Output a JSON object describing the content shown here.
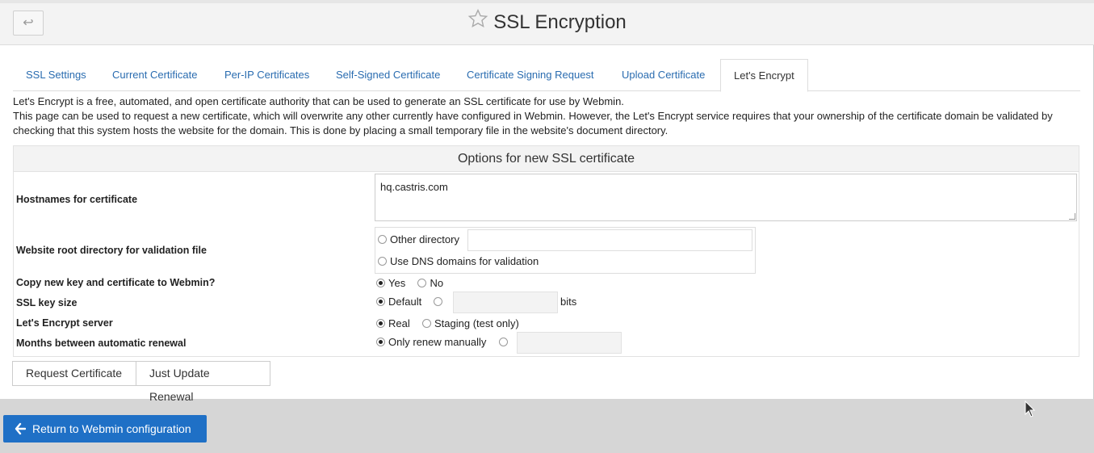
{
  "header": {
    "back_glyph": "↩",
    "title": "SSL Encryption"
  },
  "tabs": [
    {
      "label": "SSL Settings"
    },
    {
      "label": "Current Certificate"
    },
    {
      "label": "Per-IP Certificates"
    },
    {
      "label": "Self-Signed Certificate"
    },
    {
      "label": "Certificate Signing Request"
    },
    {
      "label": "Upload Certificate"
    },
    {
      "label": "Let's Encrypt"
    }
  ],
  "intro": {
    "line1": "Let's Encrypt is a free, automated, and open certificate authority that can be used to generate an SSL certificate for use by Webmin.",
    "line2": "This page can be used to request a new certificate, which will overwrite any other currently have configured in Webmin. However, the Let's Encrypt service requires that your ownership of the certificate domain be validated by checking that this system hosts the website for the domain. This is done by placing a small temporary file in the website's document directory."
  },
  "options": {
    "heading": "Options for new SSL certificate",
    "hostnames_label": "Hostnames for certificate",
    "hostnames_value": "hq.castris.com",
    "webroot_label": "Website root directory for validation file",
    "other_dir": "Other directory",
    "dns_validation": "Use DNS domains for validation",
    "copy_label": "Copy new key and certificate to Webmin?",
    "yes": "Yes",
    "no": "No",
    "keysize_label": "SSL key size",
    "default": "Default",
    "bits": "bits",
    "server_label": "Let's Encrypt server",
    "real": "Real",
    "staging": "Staging (test only)",
    "renewal_label": "Months between automatic renewal",
    "renew_manual": "Only renew manually"
  },
  "buttons": {
    "request": "Request Certificate",
    "update": "Just Update Renewal",
    "return": "Return to Webmin configuration"
  },
  "colors": {
    "accent": "#1f70c6",
    "link": "#2a6cb0"
  }
}
